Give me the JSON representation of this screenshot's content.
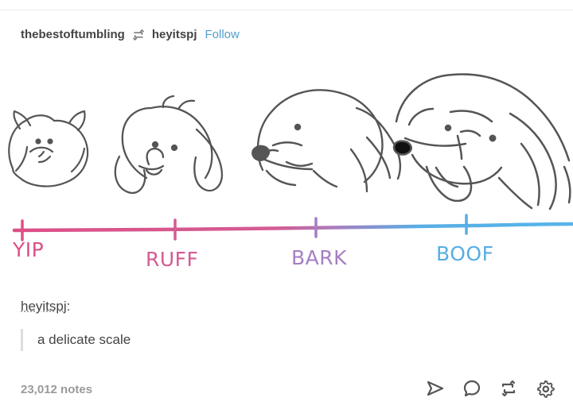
{
  "post": {
    "blog_name": "thebestoftumbling",
    "reblogged_from": "heyitspj",
    "follow_label": "Follow",
    "image": {
      "scale_labels": [
        "YIP",
        "RUFF",
        "BARK",
        "BOOF"
      ],
      "colors": {
        "yip": "#dd4f86",
        "ruff": "#d35c93",
        "bark": "#a57fc1",
        "boof": "#57aee4",
        "line_left": "#dd4f86",
        "line_right": "#57b5ea"
      }
    },
    "caption": {
      "source_name": "heyitspj",
      "source_suffix": ":",
      "quote": "a delicate scale"
    },
    "notes": "23,012 notes",
    "actions": [
      "share-icon",
      "reply-icon",
      "reblog-icon",
      "settings-icon"
    ]
  },
  "colors": {
    "accent": "#529ecc",
    "text": "#444444",
    "muted": "#9a9a9a"
  }
}
